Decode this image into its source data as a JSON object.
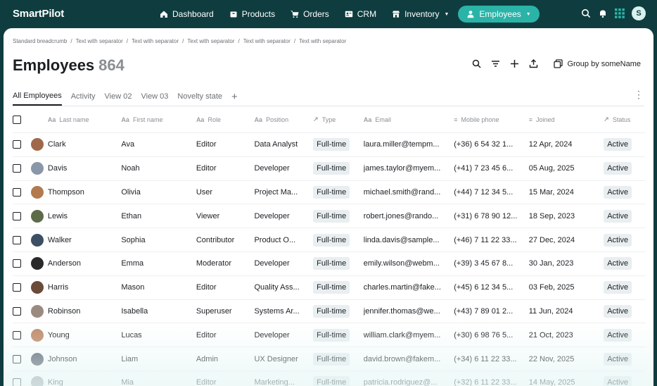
{
  "app": {
    "logo": "SmartPilot"
  },
  "nav": [
    {
      "label": "Dashboard",
      "icon": "home-icon"
    },
    {
      "label": "Products",
      "icon": "box-icon"
    },
    {
      "label": "Orders",
      "icon": "cart-icon"
    },
    {
      "label": "CRM",
      "icon": "contact-card-icon"
    },
    {
      "label": "Inventory",
      "icon": "store-icon",
      "dropdown": true
    },
    {
      "label": "Employees",
      "icon": "person-icon",
      "dropdown": true,
      "active": true
    }
  ],
  "user": {
    "initial": "S"
  },
  "breadcrumb": [
    "Standard breadcrumb",
    "Text with separator",
    "Text with separator",
    "Text with separator",
    "Text with separator",
    "Text with separator"
  ],
  "page": {
    "title": "Employees",
    "count": "864"
  },
  "toolbar": {
    "group_by_label": "Group by someName"
  },
  "tabs": [
    "All Employees",
    "Activity",
    "View 02",
    "View 03",
    "Novelty state"
  ],
  "columns": {
    "last_name": "Last name",
    "first_name": "First name",
    "role": "Role",
    "position": "Position",
    "type": "Type",
    "email": "Email",
    "mobile": "Mobile phone",
    "joined": "Joined",
    "status": "Status"
  },
  "rows": [
    {
      "last": "Clark",
      "first": "Ava",
      "role": "Editor",
      "position": "Data Analyst",
      "type": "Full-time",
      "email": "laura.miller@tempm...",
      "mobile": "(+36) 6 54 32 1...",
      "joined": "12 Apr, 2024",
      "status": "Active",
      "avatar": "#a0684a"
    },
    {
      "last": "Davis",
      "first": "Noah",
      "role": "Editor",
      "position": "Developer",
      "type": "Full-time",
      "email": "james.taylor@myem...",
      "mobile": "(+41) 7 23 45 6...",
      "joined": "05 Aug, 2025",
      "status": "Active",
      "avatar": "#8a97a8"
    },
    {
      "last": "Thompson",
      "first": "Olivia",
      "role": "User",
      "position": "Project Ma...",
      "type": "Full-time",
      "email": "michael.smith@rand...",
      "mobile": "(+44) 7 12 34 5...",
      "joined": "15 Mar, 2024",
      "status": "Active",
      "avatar": "#b27a4e"
    },
    {
      "last": "Lewis",
      "first": "Ethan",
      "role": "Viewer",
      "position": "Developer",
      "type": "Full-time",
      "email": "robert.jones@rando...",
      "mobile": "(+31) 6 78 90 12...",
      "joined": "18 Sep, 2023",
      "status": "Active",
      "avatar": "#5d6b4a"
    },
    {
      "last": "Walker",
      "first": "Sophia",
      "role": "Contributor",
      "position": "Product O...",
      "type": "Full-time",
      "email": "linda.davis@sample...",
      "mobile": "(+46) 7 11 22 33...",
      "joined": "27 Dec, 2024",
      "status": "Active",
      "avatar": "#3c4f63"
    },
    {
      "last": "Anderson",
      "first": "Emma",
      "role": "Moderator",
      "position": "Developer",
      "type": "Full-time",
      "email": "emily.wilson@webm...",
      "mobile": "(+39) 3 45 67 8...",
      "joined": "30 Jan, 2023",
      "status": "Active",
      "avatar": "#2a2a2a"
    },
    {
      "last": "Harris",
      "first": "Mason",
      "role": "Editor",
      "position": "Quality Ass...",
      "type": "Full-time",
      "email": "charles.martin@fake...",
      "mobile": "(+45) 6 12 34 5...",
      "joined": "03 Feb, 2025",
      "status": "Active",
      "avatar": "#6b4a3a"
    },
    {
      "last": "Robinson",
      "first": "Isabella",
      "role": "Superuser",
      "position": "Systems Ar...",
      "type": "Full-time",
      "email": "jennifer.thomas@we...",
      "mobile": "(+43) 7 89 01 2...",
      "joined": "11 Jun, 2024",
      "status": "Active",
      "avatar": "#9a8a80"
    },
    {
      "last": "Young",
      "first": "Lucas",
      "role": "Editor",
      "position": "Developer",
      "type": "Full-time",
      "email": "william.clark@myem...",
      "mobile": "(+30) 6 98 76 5...",
      "joined": "21 Oct, 2023",
      "status": "Active",
      "avatar": "#c08a6a"
    },
    {
      "last": "Johnson",
      "first": "Liam",
      "role": "Admin",
      "position": "UX Designer",
      "type": "Full-time",
      "email": "david.brown@fakem...",
      "mobile": "(+34) 6 11 22 33...",
      "joined": "22 Nov, 2025",
      "status": "Active",
      "avatar": "#5a6070"
    },
    {
      "last": "King",
      "first": "Mia",
      "role": "Editor",
      "position": "Marketing...",
      "type": "Full-time",
      "email": "patricia.rodriguez@...",
      "mobile": "(+32) 6 11 22 33...",
      "joined": "14 May, 2025",
      "status": "Active",
      "avatar": "#9aa0a8"
    }
  ],
  "colors": {
    "nav_bg": "#0f3d3f",
    "accent": "#2bb3a8"
  }
}
